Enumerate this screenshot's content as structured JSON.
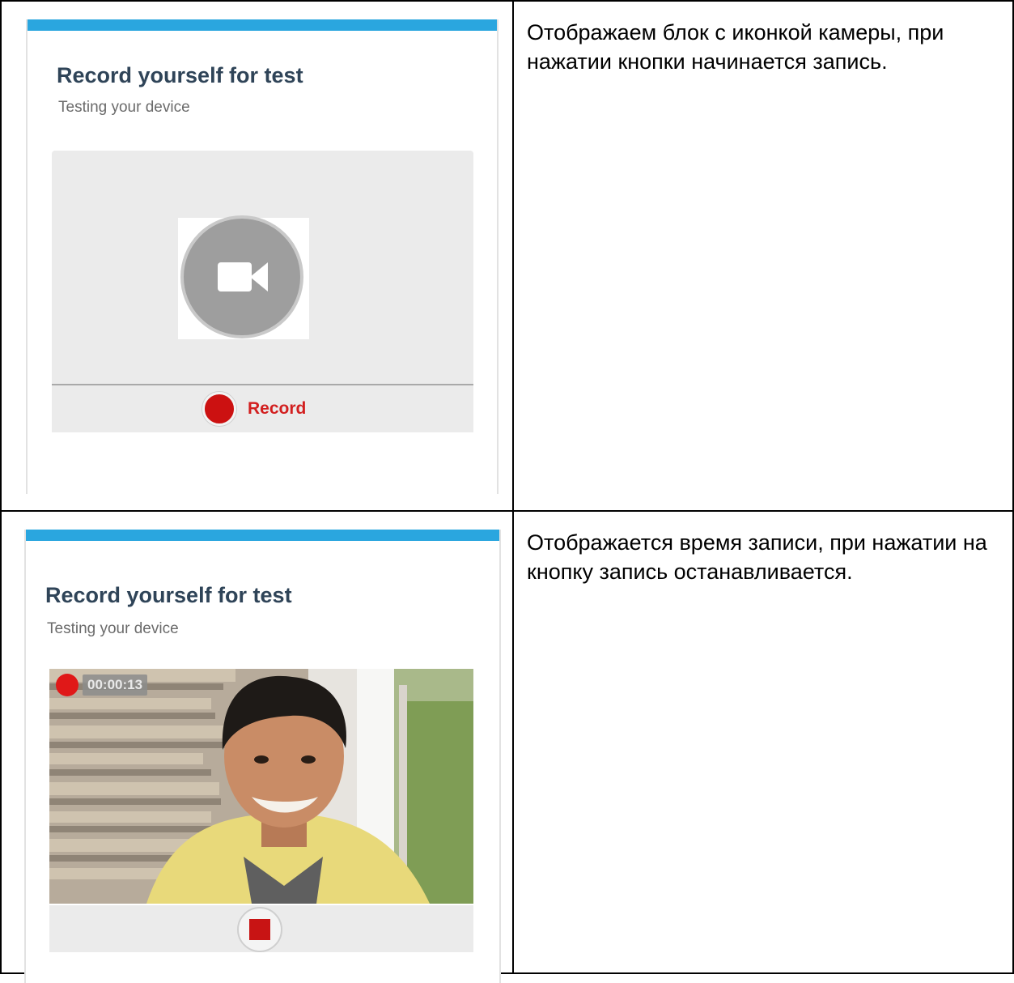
{
  "step1": {
    "card": {
      "title": "Record yourself for test",
      "subtitle": "Testing your device",
      "camera_icon": "video-camera-icon",
      "record_label": "Record"
    },
    "description": "Отображаем блок с иконкой камеры, при нажатии кнопки начинается запись."
  },
  "step2": {
    "card": {
      "title": "Record yourself for test",
      "subtitle": "Testing your device",
      "timer": "00:00:13",
      "stop_icon": "stop-icon"
    },
    "description": "Отображается время записи, при нажатии на кнопку запись останавливается."
  },
  "colors": {
    "accent_bar": "#2aa6df",
    "title": "#2f4458",
    "record_red": "#d21f1f"
  }
}
